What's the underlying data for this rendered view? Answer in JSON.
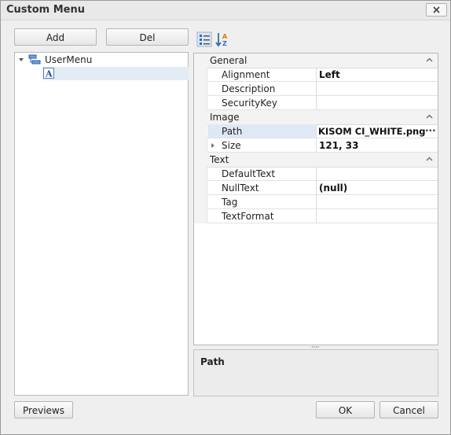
{
  "window": {
    "title": "Custom Menu",
    "close_icon": "close-icon"
  },
  "buttons": {
    "add": "Add",
    "del": "Del",
    "previews": "Previews",
    "ok": "OK",
    "cancel": "Cancel"
  },
  "tree": {
    "root_label": "UserMenu",
    "child_label": ""
  },
  "toolbar": {
    "categorized_icon": "categorized-icon",
    "alphabetical_icon": "sort-az-icon"
  },
  "properties": {
    "categories": [
      {
        "name": "General"
      },
      {
        "name": "Image"
      },
      {
        "name": "Text"
      }
    ],
    "rows": {
      "alignment": {
        "name": "Alignment",
        "value": "Left"
      },
      "description": {
        "name": "Description",
        "value": ""
      },
      "securitykey": {
        "name": "SecurityKey",
        "value": ""
      },
      "path": {
        "name": "Path",
        "value": "KISOM CI_WHITE.png",
        "ellipsis": "···"
      },
      "size": {
        "name": "Size",
        "value": "121, 33"
      },
      "defaulttext": {
        "name": "DefaultText",
        "value": ""
      },
      "nulltext": {
        "name": "NullText",
        "value": "(null)"
      },
      "tag": {
        "name": "Tag",
        "value": ""
      },
      "textformat": {
        "name": "TextFormat",
        "value": ""
      }
    }
  },
  "description_panel": {
    "title": "Path"
  },
  "colors": {
    "selection": "#e3ebf5",
    "category_bg": "#f3f3f3"
  }
}
